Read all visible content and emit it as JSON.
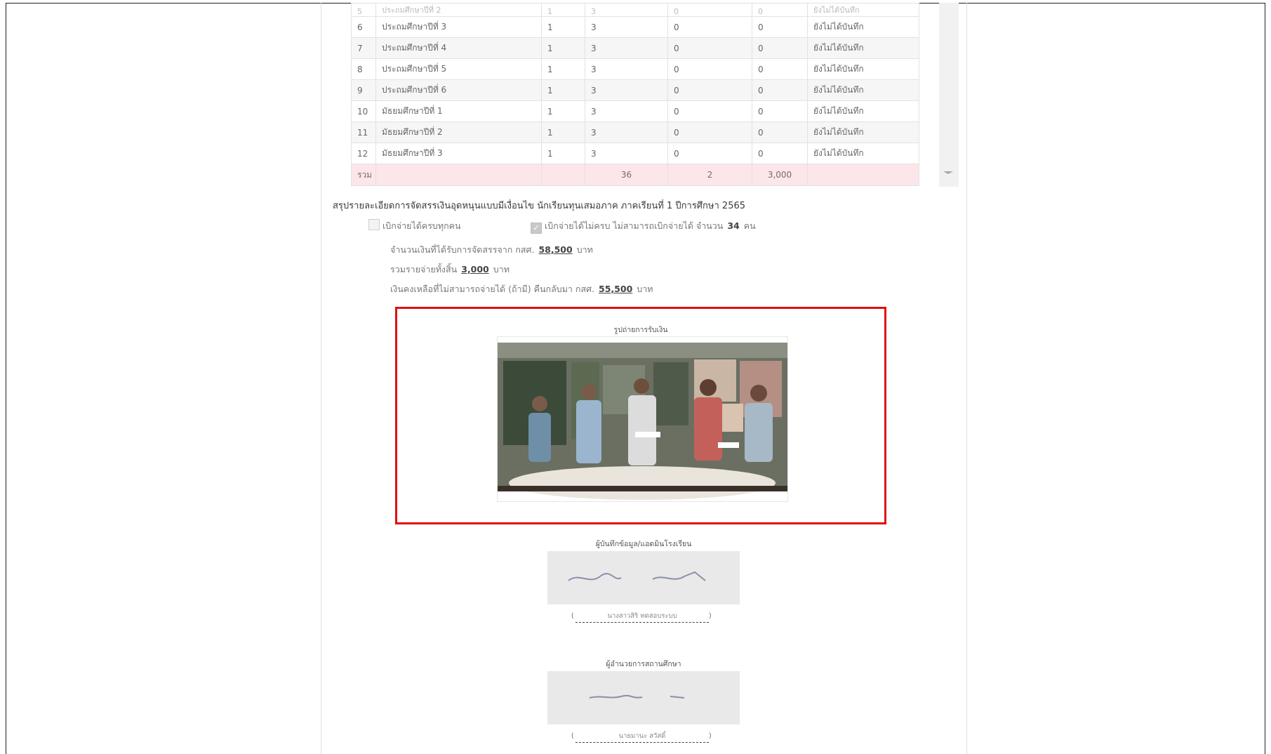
{
  "table": {
    "stub_row": {
      "no": "5",
      "name": "ประถมศึกษาปีที่ 2",
      "c1": "1",
      "c2": "3",
      "c3": "0",
      "c4": "0",
      "status": "ยังไม่ได้บันทึก"
    },
    "rows": [
      {
        "no": "6",
        "name": "ประถมศึกษาปีที่ 3",
        "c1": "1",
        "c2": "3",
        "c3": "0",
        "c4": "0",
        "status": "ยังไม่ได้บันทึก"
      },
      {
        "no": "7",
        "name": "ประถมศึกษาปีที่ 4",
        "c1": "1",
        "c2": "3",
        "c3": "0",
        "c4": "0",
        "status": "ยังไม่ได้บันทึก"
      },
      {
        "no": "8",
        "name": "ประถมศึกษาปีที่ 5",
        "c1": "1",
        "c2": "3",
        "c3": "0",
        "c4": "0",
        "status": "ยังไม่ได้บันทึก"
      },
      {
        "no": "9",
        "name": "ประถมศึกษาปีที่ 6",
        "c1": "1",
        "c2": "3",
        "c3": "0",
        "c4": "0",
        "status": "ยังไม่ได้บันทึก"
      },
      {
        "no": "10",
        "name": "มัธยมศึกษาปีที่ 1",
        "c1": "1",
        "c2": "3",
        "c3": "0",
        "c4": "0",
        "status": "ยังไม่ได้บันทึก"
      },
      {
        "no": "11",
        "name": "มัธยมศึกษาปีที่ 2",
        "c1": "1",
        "c2": "3",
        "c3": "0",
        "c4": "0",
        "status": "ยังไม่ได้บันทึก"
      },
      {
        "no": "12",
        "name": "มัธยมศึกษาปีที่ 3",
        "c1": "1",
        "c2": "3",
        "c3": "0",
        "c4": "0",
        "status": "ยังไม่ได้บันทึก"
      }
    ],
    "total": {
      "label": "รวม",
      "c2": "36",
      "c3": "2",
      "c4": "3,000"
    }
  },
  "summary": {
    "title": "สรุปรายละเอียดการจัดสรรเงินอุดหนุนแบบมีเงื่อนไข นักเรียนทุนเสมอภาค ภาคเรียนที่ 1 ปีการศึกษา 2565",
    "option_all": {
      "label": "เบิกจ่ายได้ครบทุกคน",
      "checked": false
    },
    "option_partial": {
      "label": "เบิกจ่ายได้ไม่ครบ ไม่สามารถเบิกจ่ายได้ จำนวน",
      "count": "34",
      "unit": "คน",
      "checked": true
    },
    "received": {
      "label": "จำนวนเงินที่ได้รับการจัดสรรจาก กสศ.",
      "value": "58,500",
      "unit": "บาท"
    },
    "spent": {
      "label": "รวมรายจ่ายทั้งสิ้น",
      "value": "3,000",
      "unit": "บาท"
    },
    "remaining": {
      "label": "เงินคงเหลือที่ไม่สามารถจ่ายได้ (ถ้ามี) คืนกลับมา กสศ.",
      "value": "55,500",
      "unit": "บาท"
    }
  },
  "photo": {
    "title": "รูปถ่ายการรับเงิน"
  },
  "signatures": [
    {
      "title": "ผู้บันทึกข้อมูล/แอดมินโรงเรียน",
      "name": "นางสาวสิริ ทดสอบระบบ"
    },
    {
      "title": "ผู้อำนวยการสถานศึกษา",
      "name": "นายมานะ สวัสดิ์"
    }
  ],
  "colors": {
    "highlight_border": "#e01010",
    "total_row_bg": "#fce6e9"
  }
}
